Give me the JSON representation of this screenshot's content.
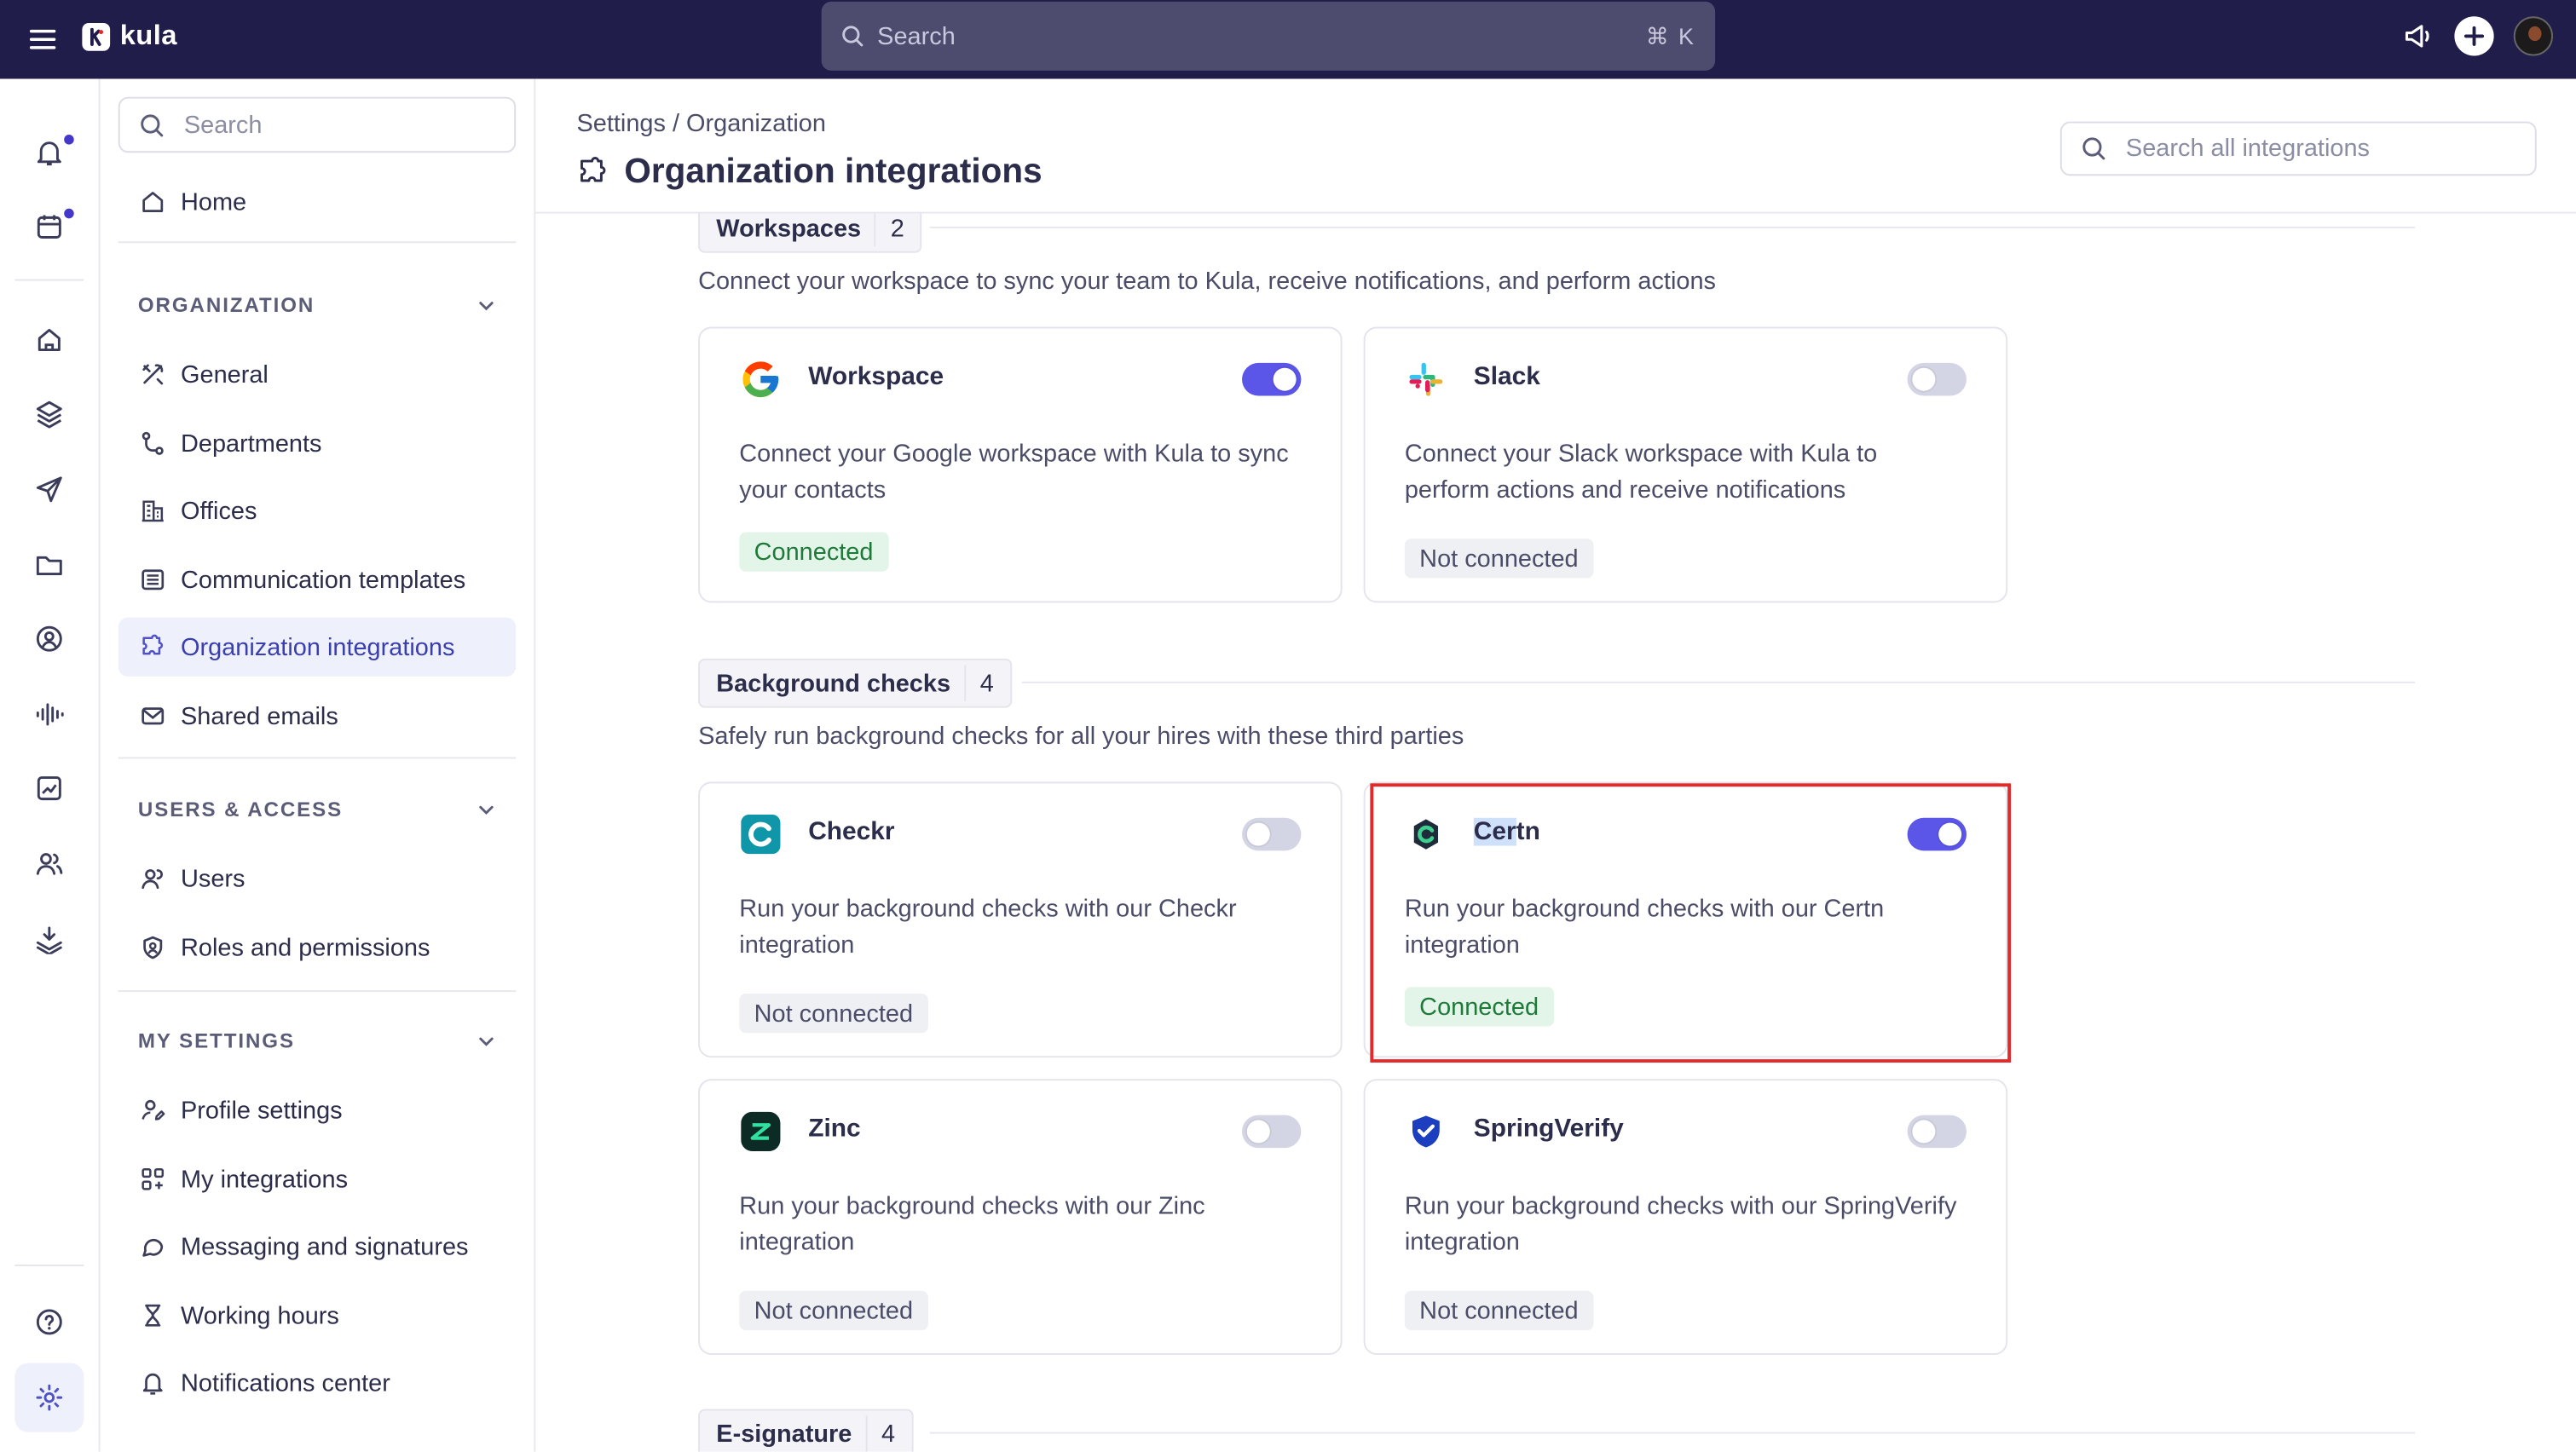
{
  "topbar": {
    "app_name": "kula",
    "search_placeholder": "Search",
    "search_shortcut": "⌘ K"
  },
  "rail": {
    "items": [
      "notifications",
      "calendar",
      "home",
      "layers",
      "send",
      "folder",
      "contacts",
      "audio",
      "insights",
      "people",
      "download"
    ],
    "bottom": [
      "help",
      "settings"
    ]
  },
  "sidebar": {
    "search_placeholder": "Search",
    "home": "Home",
    "sections": [
      {
        "title": "ORGANIZATION",
        "items": [
          "General",
          "Departments",
          "Offices",
          "Communication templates",
          "Organization integrations",
          "Shared emails"
        ]
      },
      {
        "title": "USERS & ACCESS",
        "items": [
          "Users",
          "Roles and permissions"
        ]
      },
      {
        "title": "MY SETTINGS",
        "items": [
          "Profile settings",
          "My integrations",
          "Messaging and signatures",
          "Working hours",
          "Notifications center"
        ]
      }
    ],
    "active_item": "Organization integrations"
  },
  "header": {
    "breadcrumb": "Settings / Organization",
    "title": "Organization integrations",
    "integrations_search_placeholder": "Search all integrations"
  },
  "workspaces": {
    "title": "Workspaces",
    "count": "2",
    "description": "Connect your workspace to sync your team to Kula, receive notifications, and perform actions",
    "cards": [
      {
        "name": "Workspace",
        "description": "Connect your Google workspace with Kula to sync your contacts",
        "status": "Connected",
        "enabled": true,
        "icon": "google-icon"
      },
      {
        "name": "Slack",
        "description": "Connect your Slack workspace with Kula to perform actions and receive notifications",
        "status": "Not connected",
        "enabled": false,
        "icon": "slack-icon"
      }
    ]
  },
  "background_checks": {
    "title": "Background checks",
    "count": "4",
    "description": "Safely run background checks for all your hires with these third parties",
    "cards": [
      {
        "name": "Checkr",
        "description": "Run your background checks with our Checkr integration",
        "status": "Not connected",
        "enabled": false,
        "icon": "checkr-icon"
      },
      {
        "name_selected": "Cer",
        "name_rest": "tn",
        "description": "Run your background checks with our Certn integration",
        "status": "Connected",
        "enabled": true,
        "icon": "certn-icon"
      },
      {
        "name": "Zinc",
        "description": "Run your background checks with our Zinc integration",
        "status": "Not connected",
        "enabled": false,
        "icon": "zinc-icon"
      },
      {
        "name": "SpringVerify",
        "description": "Run your background checks with our SpringVerify integration",
        "status": "Not connected",
        "enabled": false,
        "icon": "springverify-icon"
      }
    ]
  },
  "esignature": {
    "title": "E-signature",
    "count": "4"
  },
  "colors": {
    "topbar": "#201d4a",
    "accent": "#5b55e8",
    "connected_bg": "#e3f5e8",
    "connected_text": "#1f7a3a",
    "highlight": "#e5282a"
  }
}
